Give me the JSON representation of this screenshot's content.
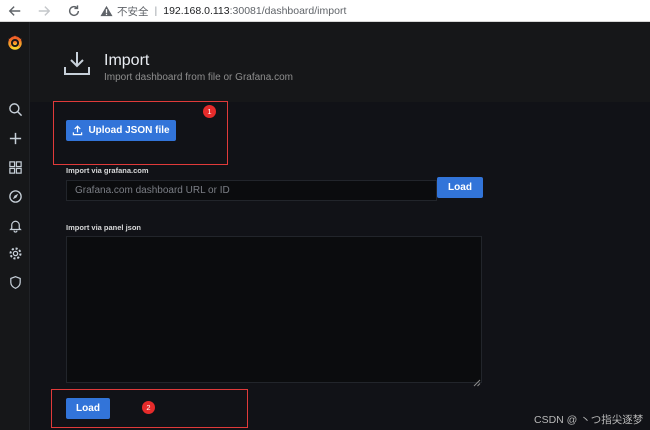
{
  "browser": {
    "security_label": "不安全",
    "separator": "|",
    "url_host": "192.168.0.113",
    "url_path": ":30081/dashboard/import"
  },
  "sidebar": {
    "items": [
      {
        "icon": "search-icon"
      },
      {
        "icon": "plus-icon"
      },
      {
        "icon": "dashboards-grid-icon"
      },
      {
        "icon": "compass-icon"
      },
      {
        "icon": "bell-icon"
      },
      {
        "icon": "gear-icon"
      },
      {
        "icon": "shield-icon"
      }
    ]
  },
  "page": {
    "title": "Import",
    "subtitle": "Import dashboard from file or Grafana.com"
  },
  "upload": {
    "button_label": "Upload JSON file"
  },
  "grafana_com": {
    "label": "Import via grafana.com",
    "placeholder": "Grafana.com dashboard URL or ID",
    "value": "",
    "load_label": "Load"
  },
  "panel_json": {
    "label": "Import via panel json",
    "value": "",
    "load_label": "Load"
  },
  "annotations": {
    "badge_1": "1",
    "badge_2": "2",
    "color": "#e03a3a"
  },
  "watermark": "CSDN @ 丶つ指尖逐梦",
  "colors": {
    "primary_button": "#3274d9",
    "background": "#111217",
    "header_bg": "#161719"
  }
}
